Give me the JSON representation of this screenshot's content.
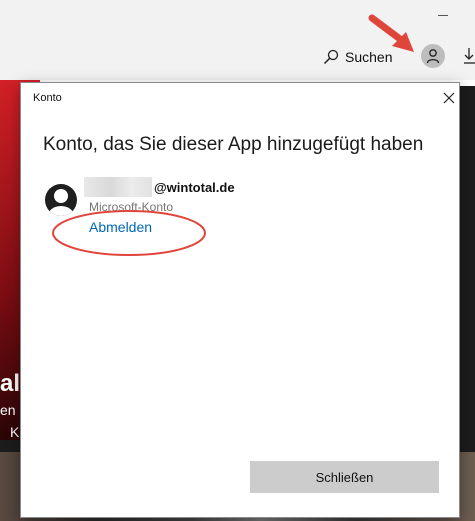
{
  "app": {
    "search_label": "Suchen",
    "background_text_1": "al",
    "background_text_2": "en",
    "background_text_3": "K"
  },
  "dialog": {
    "title": "Konto",
    "heading": "Konto, das Sie dieser App hinzugefügt haben",
    "account": {
      "email_domain": "@wintotal.de",
      "type": "Microsoft-Konto",
      "signout_label": "Abmelden"
    },
    "close_button_label": "Schließen"
  },
  "colors": {
    "link": "#0067b8",
    "annotation_red": "#e0453c",
    "button_bg": "#cccccc"
  },
  "icons": [
    "search-icon",
    "user-icon",
    "download-icon",
    "close-icon",
    "avatar-icon"
  ]
}
